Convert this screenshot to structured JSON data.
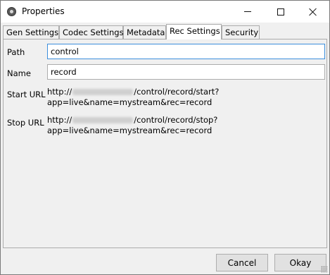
{
  "window": {
    "title": "Properties",
    "icon": "app-icon",
    "controls": [
      "minimize-icon",
      "maximize-icon",
      "close-icon"
    ]
  },
  "tabs": [
    {
      "label": "Gen Settings"
    },
    {
      "label": "Codec Settings"
    },
    {
      "label": "Metadata"
    },
    {
      "label": "Rec Settings",
      "active": true
    },
    {
      "label": "Security"
    }
  ],
  "form": {
    "path": {
      "label": "Path",
      "value": "control"
    },
    "name": {
      "label": "Name",
      "value": "record"
    },
    "start_url": {
      "label": "Start URL",
      "prefix": "http://",
      "suffix_line1": "/control/record/start?",
      "line2": "app=live&name=mystream&rec=record"
    },
    "stop_url": {
      "label": "Stop URL",
      "prefix": "http://",
      "suffix_line1": "/control/record/stop?",
      "line2": "app=live&name=mystream&rec=record"
    }
  },
  "footer": {
    "cancel_label": "Cancel",
    "okay_label": "Okay"
  },
  "colors": {
    "focus_border": "#3c8edc",
    "dialog_bg": "#f0f0f0"
  }
}
